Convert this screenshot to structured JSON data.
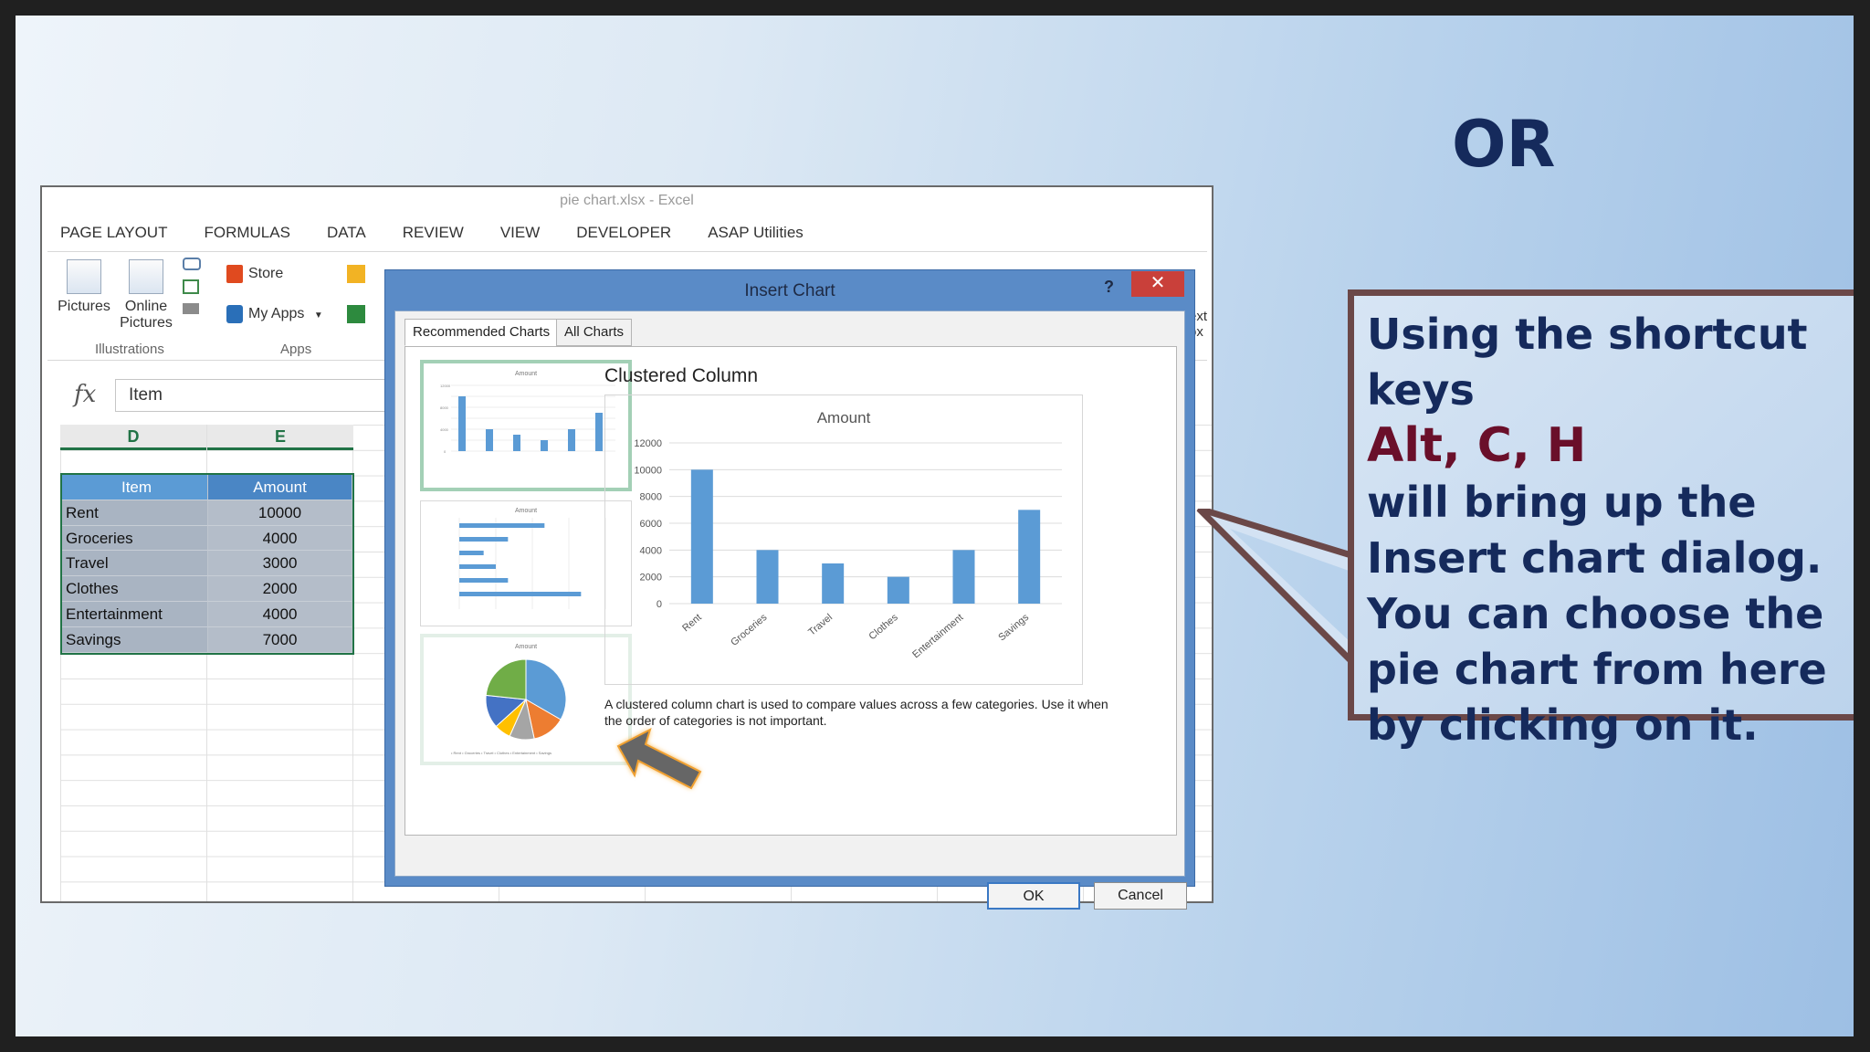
{
  "slide": {
    "or_title": "OR",
    "callout": {
      "line1": "Using the shortcut keys",
      "keys": "Alt, C,  H",
      "line3": "will bring up the Insert chart dialog. You can choose the pie chart from here by clicking on it."
    }
  },
  "excel": {
    "title": "pie chart.xlsx - Excel",
    "tabs": [
      "PAGE LAYOUT",
      "FORMULAS",
      "DATA",
      "REVIEW",
      "VIEW",
      "DEVELOPER",
      "ASAP Utilities"
    ],
    "ribbon": {
      "pictures": "Pictures",
      "online_pictures": "Online Pictures",
      "illustrations": "Illustrations",
      "store": "Store",
      "my_apps": "My Apps",
      "apps": "Apps",
      "text_box_partial_1": "ext",
      "text_box_partial_2": "ox"
    },
    "formula_bar": {
      "fx": "fx",
      "value": "Item"
    },
    "columns": [
      "D",
      "E"
    ],
    "table": {
      "headers": [
        "Item",
        "Amount"
      ],
      "rows": [
        [
          "Rent",
          "10000"
        ],
        [
          "Groceries",
          "4000"
        ],
        [
          "Travel",
          "3000"
        ],
        [
          "Clothes",
          "2000"
        ],
        [
          "Entertainment",
          "4000"
        ],
        [
          "Savings",
          "7000"
        ]
      ]
    }
  },
  "dialog": {
    "title": "Insert Chart",
    "help": "?",
    "close": "✕",
    "tabs": [
      "Recommended Charts",
      "All Charts"
    ],
    "chart_name": "Clustered Column",
    "description": "A clustered column chart is used to compare values across a few categories. Use it when the order of categories is not important.",
    "ok": "OK",
    "cancel": "Cancel",
    "thumb_title": "Amount"
  },
  "chart_data": {
    "type": "bar",
    "title": "Amount",
    "categories": [
      "Rent",
      "Groceries",
      "Travel",
      "Clothes",
      "Entertainment",
      "Savings"
    ],
    "values": [
      10000,
      4000,
      3000,
      2000,
      4000,
      7000
    ],
    "yticks": [
      "0",
      "2000",
      "4000",
      "6000",
      "8000",
      "10000",
      "12000"
    ],
    "ylim": [
      0,
      12000
    ],
    "color": "#5b9bd5",
    "grid": true
  },
  "colors": {
    "accent_blue": "#5b9bd5",
    "callout_border": "#6b4848",
    "title_navy": "#152a5c",
    "keys_red": "#6a0f2a",
    "dialog_blue": "#5a8bc7"
  }
}
